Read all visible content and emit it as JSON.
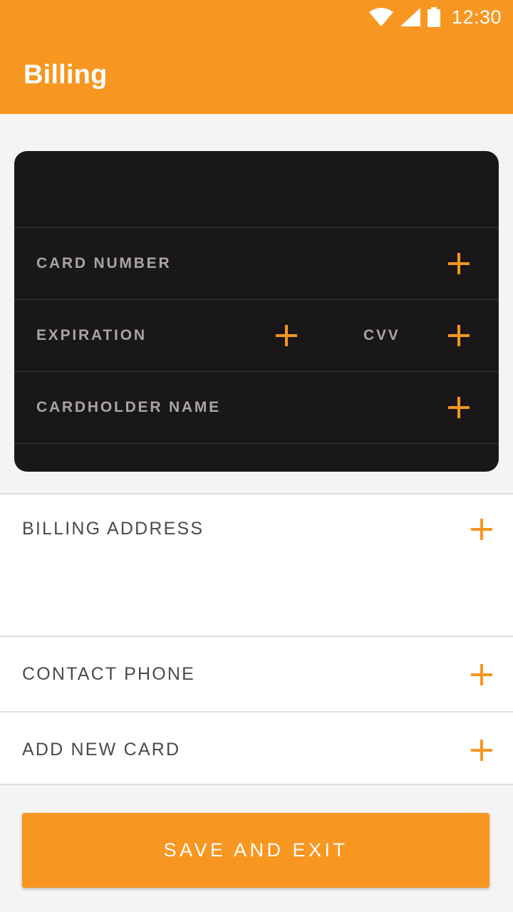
{
  "status_bar": {
    "time": "12:30"
  },
  "app_bar": {
    "title": "Billing"
  },
  "card": {
    "card_number_label": "CARD NUMBER",
    "expiration_label": "EXPIRATION",
    "cvv_label": "CVV",
    "cardholder_name_label": "CARDHOLDER NAME"
  },
  "sections": {
    "billing_address_label": "BILLING ADDRESS",
    "contact_phone_label": "CONTACT PHONE",
    "add_new_card_label": "ADD NEW CARD"
  },
  "actions": {
    "save_and_exit_label": "SAVE AND EXIT"
  },
  "colors": {
    "accent": "#f79621",
    "card_background": "#1a1718",
    "card_label": "#a9a5a6",
    "section_label": "#4a4a4a",
    "page_background": "#f4f4f4"
  },
  "icons": {
    "status": [
      "wifi-icon",
      "cell-signal-icon",
      "battery-icon"
    ],
    "add": "plus-icon"
  }
}
